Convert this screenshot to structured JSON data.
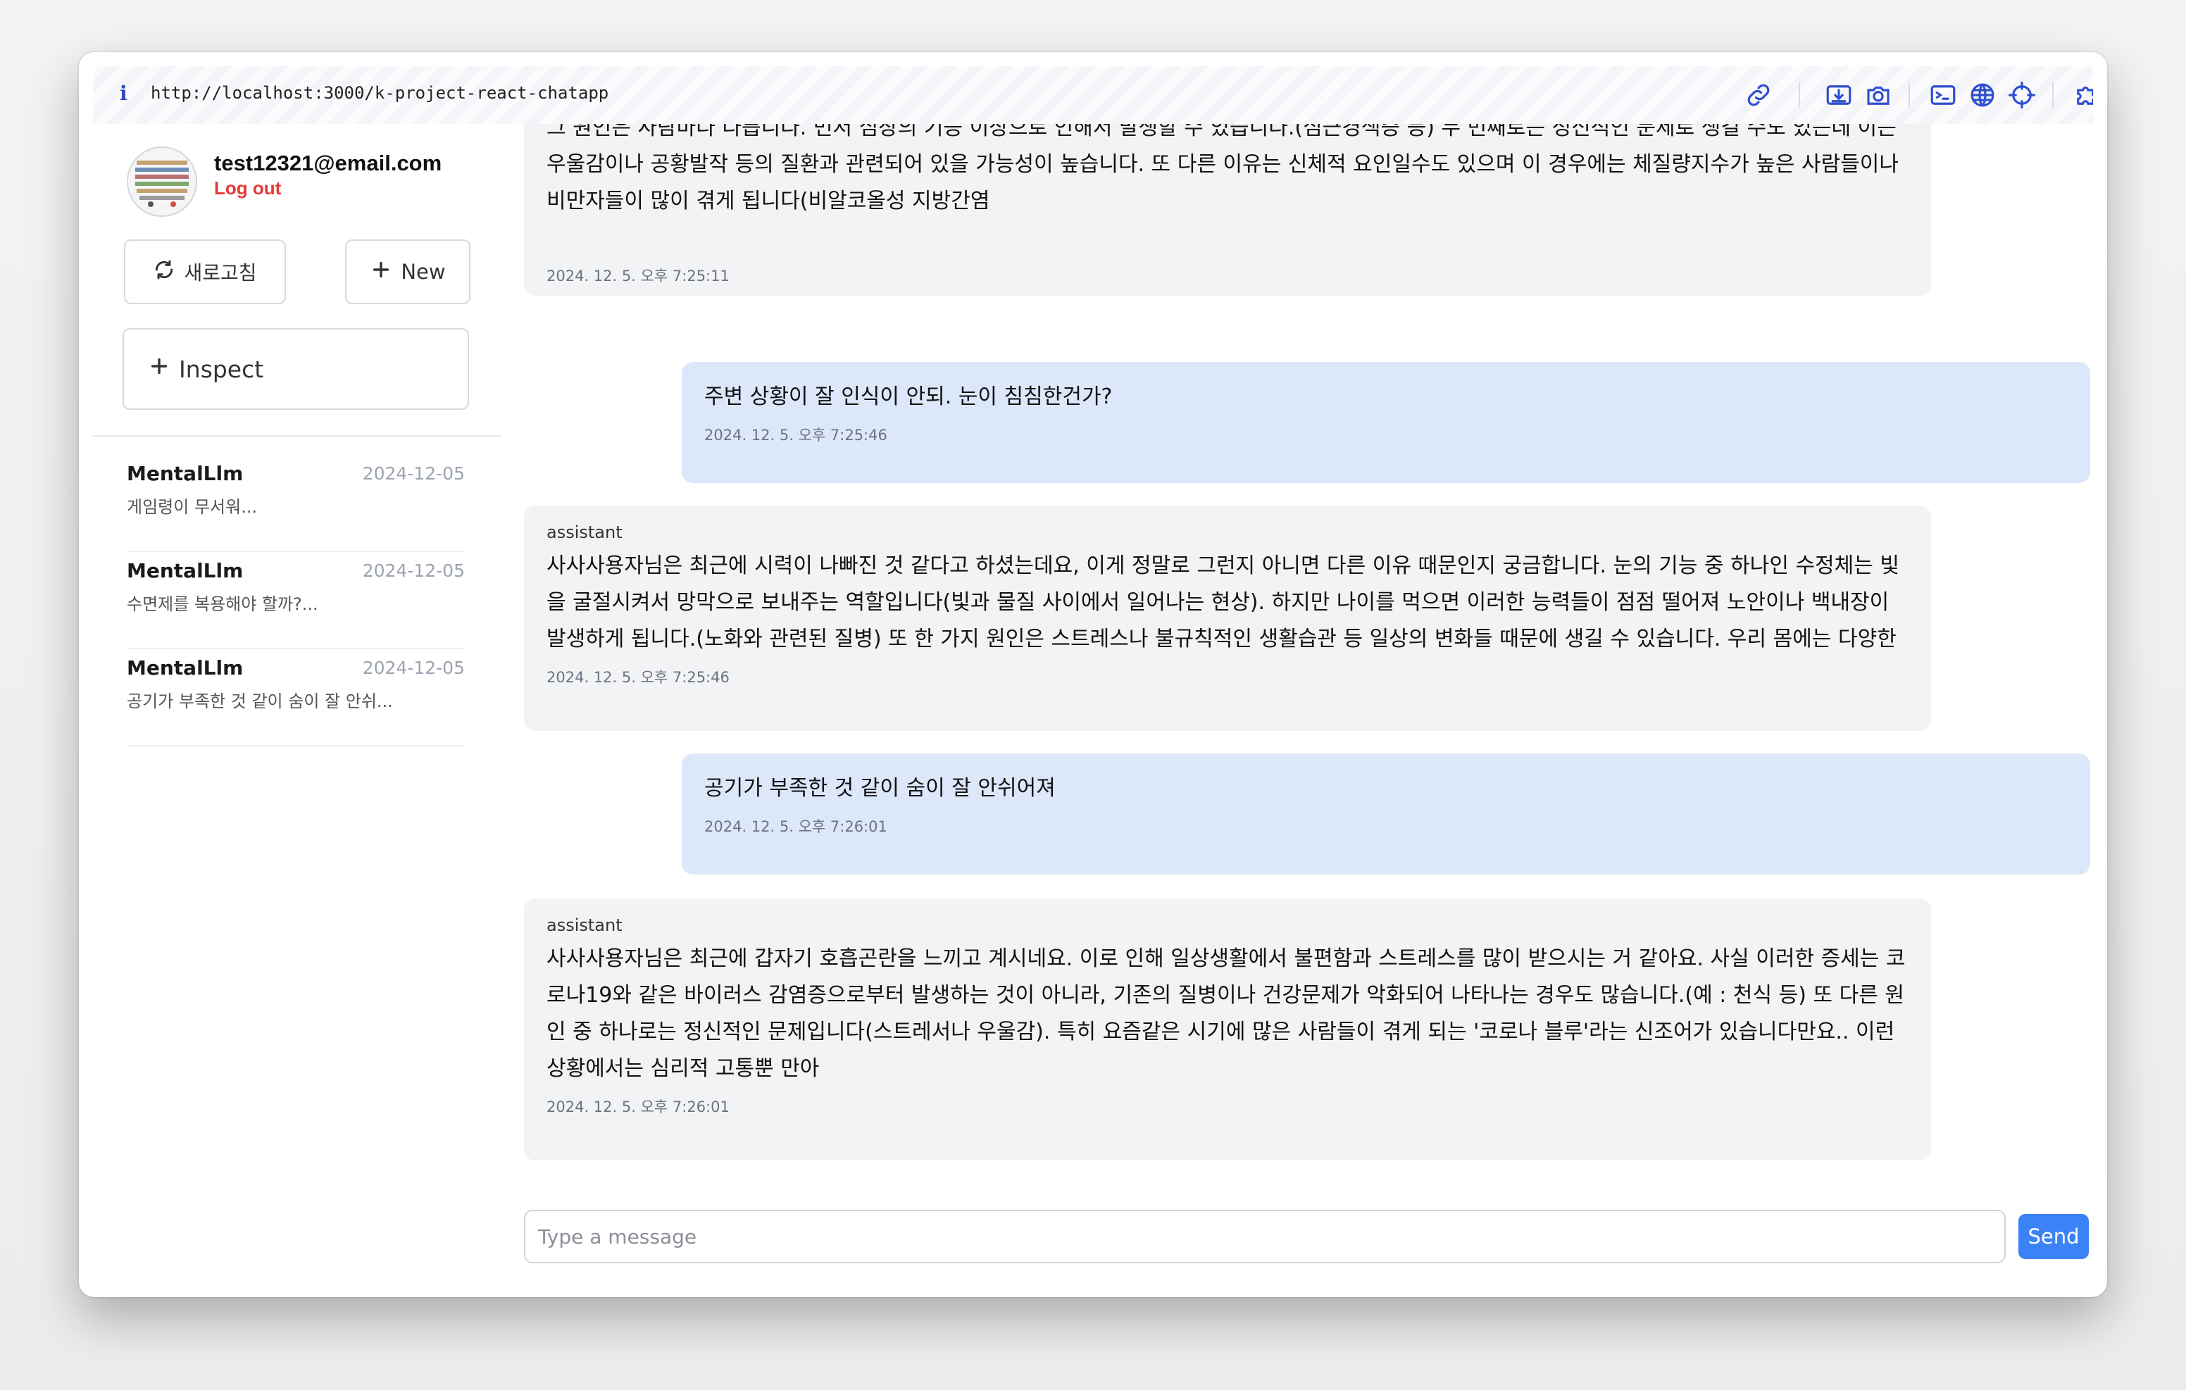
{
  "browser": {
    "url": "http://localhost:3000/k-project-react-chatapp",
    "info_icon": "i"
  },
  "user": {
    "email": "test12321@email.com",
    "logout_label": "Log out"
  },
  "sidebar": {
    "refresh_label": "새로고침",
    "new_label": "New",
    "inspect_label": "Inspect",
    "conversations": [
      {
        "title": "MentalLlm",
        "date": "2024-12-05",
        "preview": "게임령이 무서워..."
      },
      {
        "title": "MentalLlm",
        "date": "2024-12-05",
        "preview": "수면제를 복용해야 할까?..."
      },
      {
        "title": "MentalLlm",
        "date": "2024-12-05",
        "preview": "공기가 부족한 것 같이 숨이 잘 안쉬..."
      }
    ]
  },
  "chat": {
    "messages": [
      {
        "role": "assistant",
        "text": "사사사용자님, 최근에 어떤 일이 있으셨나요? 혹시 스트레스를 받거나 불안한 상황에서 일어난 일인가요? 사실상 모든 사람이 경험하는 증세입니다. 하지만 그 원인은 사람마다 다릅니다. 먼저 심장의 기능 이상으로 인해서 발생할 수 있습니다.(심근경색증 등) 두 번째로는 정신적인 문제로 생길 수도 있는데 이는 우울감이나 공황발작 등의 질환과 관련되어 있을 가능성이 높습니다. 또 다른 이유는 신체적 요인일수도 있으며 이 경우에는 체질량지수가 높은 사람들이나 비만자들이 많이 겪게 됩니다(비알코올성 지방간염",
        "time": "2024. 12. 5. 오후 7:25:11"
      },
      {
        "role": "user",
        "text": "주변 상황이 잘 인식이 안되. 눈이 침침한건가?",
        "time": "2024. 12. 5. 오후 7:25:46"
      },
      {
        "role": "assistant",
        "text": "사사사용자님은 최근에 시력이 나빠진 것 같다고 하셨는데요, 이게 정말로 그런지 아니면 다른 이유 때문인지 궁금합니다. 눈의 기능 중 하나인 수정체는 빛을 굴절시켜서 망막으로 보내주는 역할입니다(빛과 물질 사이에서 일어나는 현상). 하지만 나이를 먹으면 이러한 능력들이 점점 떨어져 노안이나 백내장이 발생하게 됩니다.(노화와 관련된 질병) 또 한 가지 원인은 스트레스나 불규칙적인 생활습관 등 일상의 변화들 때문에 생길 수 있습니다. 우리 몸에는 다양한",
        "time": "2024. 12. 5. 오후 7:25:46"
      },
      {
        "role": "user",
        "text": "공기가 부족한 것 같이 숨이 잘 안쉬어져",
        "time": "2024. 12. 5. 오후 7:26:01"
      },
      {
        "role": "assistant",
        "text": "사사사용자님은 최근에 갑자기 호흡곤란을 느끼고 계시네요. 이로 인해 일상생활에서 불편함과 스트레스를 많이 받으시는 거 같아요. 사실 이러한 증세는 코로나19와 같은 바이러스 감염증으로부터 발생하는 것이 아니라, 기존의 질병이나 건강문제가 악화되어 나타나는 경우도 많습니다.(예 : 천식 등) 또 다른 원인 중 하나로는 정신적인 문제입니다(스트레서나 우울감). 특히 요즘같은 시기에 많은 사람들이 겪게 되는 '코로나 블루'라는 신조어가 있습니다만요.. 이런 상황에서는 심리적 고통뿐 만아",
        "time": "2024. 12. 5. 오후 7:26:01"
      }
    ],
    "input_placeholder": "Type a message",
    "send_label": "Send"
  },
  "icons": [
    "link-icon",
    "download-icon",
    "camera-icon",
    "terminal-icon",
    "globe-icon",
    "crosshair-icon",
    "puzzle-icon",
    "document-icon",
    "sidebar-toggle-icon",
    "refresh-icon",
    "plus-icon"
  ],
  "colors": {
    "accent": "#3b82f6",
    "logout": "#e53935",
    "user_bubble": "#dde7fa",
    "assistant_bubble": "#f2f3f5",
    "toolbar_icon": "#2f4fcf"
  }
}
